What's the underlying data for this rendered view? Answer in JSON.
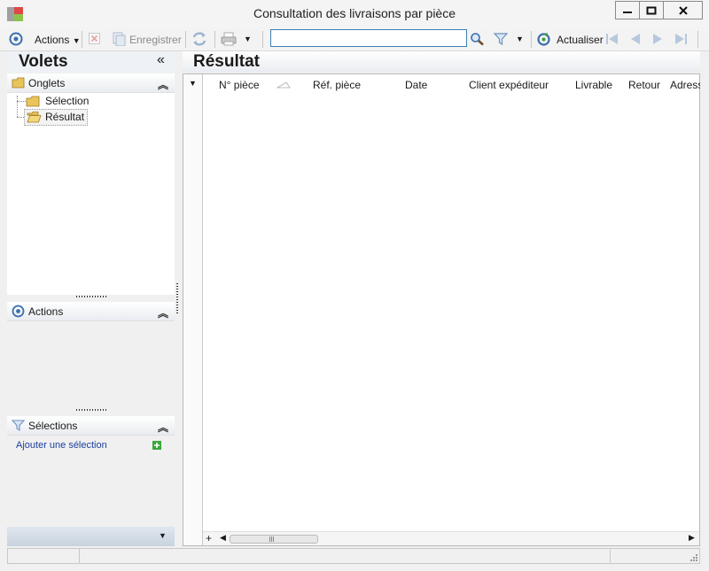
{
  "window": {
    "title": "Consultation des livraisons par pièce"
  },
  "toolbar": {
    "actions_label": "Actions",
    "save_label": "Enregistrer",
    "search_value": "",
    "refresh_label": "Actualiser"
  },
  "left_panel": {
    "title": "Volets",
    "onglets": {
      "header": "Onglets",
      "items": [
        "Sélection",
        "Résultat"
      ]
    },
    "actions": {
      "header": "Actions"
    },
    "selections": {
      "header": "Sélections",
      "add_label": "Ajouter une sélection"
    }
  },
  "result": {
    "title": "Résultat",
    "columns": [
      "N° pièce",
      "Réf. pièce",
      "Date",
      "Client expéditeur",
      "Livrable",
      "Retour",
      "Adress"
    ],
    "rows": []
  },
  "colors": {
    "accent_blue": "#3a6fb0",
    "link_blue": "#1b3f9e",
    "folder_yellow": "#e9c45a",
    "add_green": "#3aa63a"
  }
}
